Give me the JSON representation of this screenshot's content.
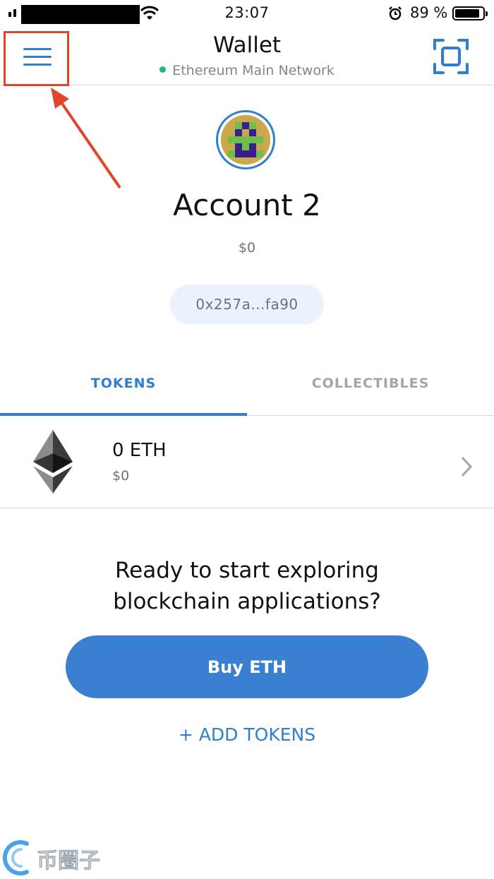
{
  "status_bar": {
    "time": "23:07",
    "battery": "89 %"
  },
  "header": {
    "title": "Wallet",
    "network": "Ethereum Main Network",
    "network_dot_color": "#29b18e"
  },
  "account": {
    "name": "Account 2",
    "balance": "$0",
    "address": "0x257a...fa90"
  },
  "tabs": [
    {
      "label": "TOKENS",
      "active": true
    },
    {
      "label": "COLLECTIBLES",
      "active": false
    }
  ],
  "tokens": [
    {
      "amount": "0 ETH",
      "fiat": "$0",
      "icon": "ethereum-icon"
    }
  ],
  "cta": {
    "line1": "Ready to start exploring",
    "line2": "blockchain applications?",
    "buy_label": "Buy ETH",
    "add_tokens_label": "+ ADD TOKENS"
  },
  "watermark": {
    "text": "币圈子"
  },
  "colors": {
    "accent": "#2f7fd1",
    "button": "#3a7fd0",
    "annotation": "#e0462a"
  }
}
